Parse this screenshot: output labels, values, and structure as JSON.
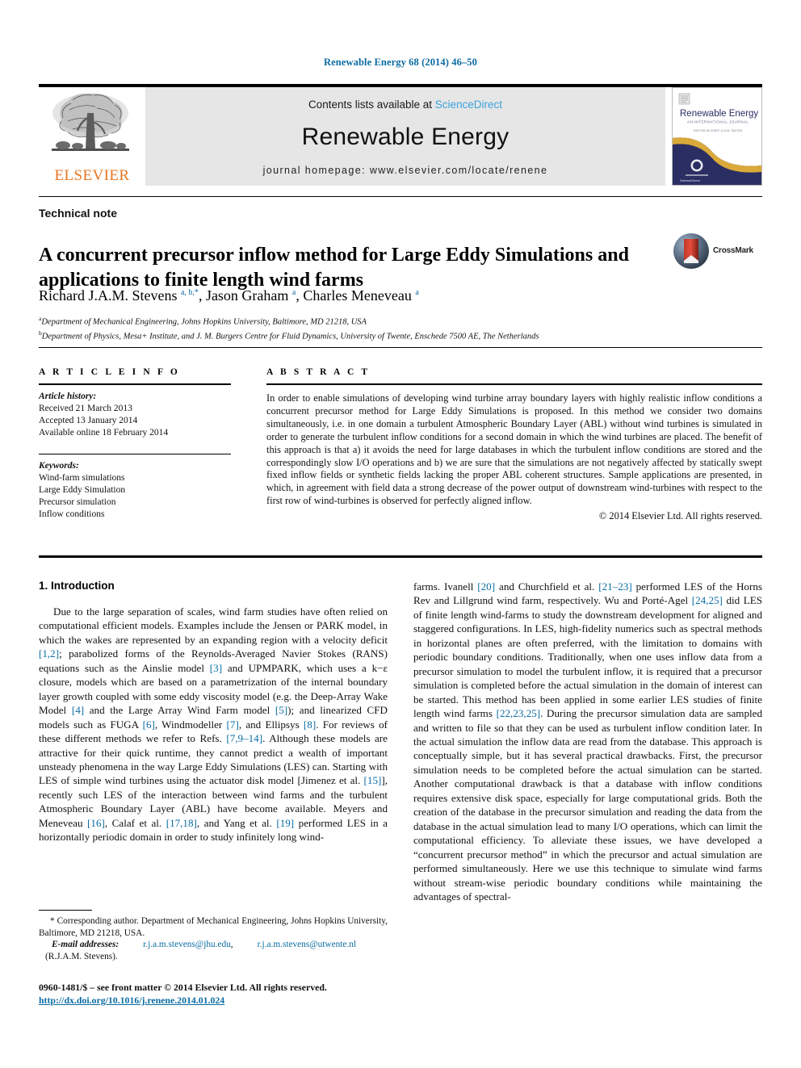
{
  "running_head": "Renewable Energy 68 (2014) 46–50",
  "masthead": {
    "publisher_name": "ELSEVIER",
    "contents_prefix": "Contents lists available at ",
    "sciencedirect": "ScienceDirect",
    "journal_title": "Renewable Energy",
    "journal_homepage": "journal homepage: www.elsevier.com/locate/renene",
    "cover_title": "Renewable Energy",
    "cover_subtitle": "AN INTERNATIONAL JOURNAL",
    "cover_tagline": "EDITOR-IN-CHIEF: A.A.M. SAYIGH",
    "cover_footer": "ScienceDirect"
  },
  "article": {
    "doc_type": "Technical note",
    "title": "A concurrent precursor inflow method for Large Eddy Simulations and applications to finite length wind farms",
    "crossmark_label": "CrossMark",
    "authors_html": "Richard J.A.M. Stevens <sup>a, b,*</sup>, Jason Graham <sup>a</sup>, Charles Meneveau <sup>a</sup>",
    "affiliations": [
      {
        "marker": "a",
        "text": "Department of Mechanical Engineering, Johns Hopkins University, Baltimore, MD 21218, USA"
      },
      {
        "marker": "b",
        "text": "Department of Physics, Mesa+ Institute, and J. M. Burgers Centre for Fluid Dynamics, University of Twente, Enschede 7500 AE, The Netherlands"
      }
    ]
  },
  "article_info": {
    "heading": "A R T I C L E  I N F O",
    "history_label": "Article history:",
    "history": [
      "Received 21 March 2013",
      "Accepted 13 January 2014",
      "Available online 18 February 2014"
    ],
    "keywords_label": "Keywords:",
    "keywords": [
      "Wind-farm simulations",
      "Large Eddy Simulation",
      "Precursor simulation",
      "Inflow conditions"
    ]
  },
  "abstract": {
    "heading": "A B S T R A C T",
    "text": "In order to enable simulations of developing wind turbine array boundary layers with highly realistic inflow conditions a concurrent precursor method for Large Eddy Simulations is proposed. In this method we consider two domains simultaneously, i.e. in one domain a turbulent Atmospheric Boundary Layer (ABL) without wind turbines is simulated in order to generate the turbulent inflow conditions for a second domain in which the wind turbines are placed. The benefit of this approach is that a) it avoids the need for large databases in which the turbulent inflow conditions are stored and the correspondingly slow I/O operations and b) we are sure that the simulations are not negatively affected by statically swept fixed inflow fields or synthetic fields lacking the proper ABL coherent structures. Sample applications are presented, in which, in agreement with field data a strong decrease of the power output of downstream wind-turbines with respect to the first row of wind-turbines is observed for perfectly aligned inflow.",
    "copyright": "© 2014 Elsevier Ltd. All rights reserved."
  },
  "body": {
    "section_title": "1. Introduction",
    "left_paragraph_parts": [
      {
        "t": "Due to the large separation of scales, wind farm studies have often relied on computational efficient models. Examples include the Jensen or PARK model, in which the wakes are represented by an expanding region with a velocity deficit "
      },
      {
        "t": "[1,2]",
        "ref": true
      },
      {
        "t": "; parabolized forms of the Reynolds-Averaged Navier Stokes (RANS) equations such as the Ainslie model "
      },
      {
        "t": "[3]",
        "ref": true
      },
      {
        "t": " and UPMPARK, which uses a k−ε closure, models which are based on a parametrization of the internal boundary layer growth coupled with some eddy viscosity model (e.g. the Deep-Array Wake Model "
      },
      {
        "t": "[4]",
        "ref": true
      },
      {
        "t": " and the Large Array Wind Farm model "
      },
      {
        "t": "[5]",
        "ref": true
      },
      {
        "t": "); and linearized CFD models such as FUGA "
      },
      {
        "t": "[6]",
        "ref": true
      },
      {
        "t": ", Windmodeller "
      },
      {
        "t": "[7]",
        "ref": true
      },
      {
        "t": ", and Ellipsys "
      },
      {
        "t": "[8]",
        "ref": true
      },
      {
        "t": ". For reviews of these different methods we refer to Refs. "
      },
      {
        "t": "[7,9–14]",
        "ref": true
      },
      {
        "t": ". Although these models are attractive for their quick runtime, they cannot predict a wealth of important unsteady phenomena in the way Large Eddy Simulations (LES) can. Starting with LES of simple wind turbines using the actuator disk model [Jimenez et al. "
      },
      {
        "t": "[15]",
        "ref": true
      },
      {
        "t": "], recently such LES of the interaction between wind farms and the turbulent Atmospheric Boundary Layer (ABL) have become available. Meyers and Meneveau "
      },
      {
        "t": "[16]",
        "ref": true
      },
      {
        "t": ", Calaf et al. "
      },
      {
        "t": "[17,18]",
        "ref": true
      },
      {
        "t": ", and Yang et al. "
      },
      {
        "t": "[19]",
        "ref": true
      },
      {
        "t": " performed LES in a horizontally periodic domain in order to study infinitely long wind-"
      }
    ],
    "right_paragraph_parts": [
      {
        "t": "farms. Ivanell "
      },
      {
        "t": "[20]",
        "ref": true
      },
      {
        "t": " and Churchfield et al. "
      },
      {
        "t": "[21–23]",
        "ref": true
      },
      {
        "t": " performed LES of the Horns Rev and Lillgrund wind farm, respectively. Wu and Porté-Agel "
      },
      {
        "t": "[24,25]",
        "ref": true
      },
      {
        "t": " did LES of finite length wind-farms to study the downstream development for aligned and staggered configurations. In LES, high-fidelity numerics such as spectral methods in horizontal planes are often preferred, with the limitation to domains with periodic boundary conditions. Traditionally, when one uses inflow data from a precursor simulation to model the turbulent inflow, it is required that a precursor simulation is completed before the actual simulation in the domain of interest can be started. This method has been applied in some earlier LES studies of finite length wind farms "
      },
      {
        "t": "[22,23,25]",
        "ref": true
      },
      {
        "t": ". During the precursor simulation data are sampled and written to file so that they can be used as turbulent inflow condition later. In the actual simulation the inflow data are read from the database. This approach is conceptually simple, but it has several practical drawbacks. First, the precursor simulation needs to be completed before the actual simulation can be started. Another computational drawback is that a database with inflow conditions requires extensive disk space, especially for large computational grids. Both the creation of the database in the precursor simulation and reading the data from the database in the actual simulation lead to many I/O operations, which can limit the computational efficiency. To alleviate these issues, we have developed a “concurrent precursor method” in which the precursor and actual simulation are performed simultaneously. Here we use this technique to simulate wind farms without stream-wise periodic boundary conditions while maintaining the advantages of spectral-"
      }
    ]
  },
  "footnote": {
    "corresponding": "* Corresponding author. Department of Mechanical Engineering, Johns Hopkins University, Baltimore, MD 21218, USA.",
    "email_label": "E-mail addresses:",
    "email1": "r.j.a.m.stevens@jhu.edu",
    "email_sep": ",",
    "email2": "r.j.a.m.stevens@utwente.nl",
    "email_attrib": "(R.J.A.M. Stevens)."
  },
  "imprint": {
    "issn_line": "0960-1481/$ – see front matter © 2014 Elsevier Ltd. All rights reserved.",
    "doi": "http://dx.doi.org/10.1016/j.renene.2014.01.024"
  },
  "colors": {
    "link": "#0b6ca3",
    "sciencedirect": "#3aa3dd",
    "elsevier_orange": "#E87722",
    "band_gray": "#e6e6e6",
    "cover_navy": "#2b2e63",
    "cover_gold": "#d9a93a"
  }
}
